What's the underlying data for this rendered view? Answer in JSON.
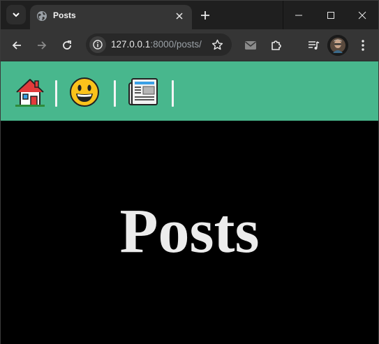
{
  "browser": {
    "tab": {
      "title": "Posts",
      "favicon": "globe-icon"
    },
    "address": {
      "host": "127.0.0.1",
      "rest": ":8000/posts/"
    },
    "icons": {
      "tab_menu": "chevron-down-icon",
      "close_tab": "close-icon",
      "new_tab": "plus-icon",
      "minimize": "minimize-icon",
      "maximize": "maximize-icon",
      "close_window": "close-icon",
      "back": "arrow-left-icon",
      "forward": "arrow-right-icon",
      "reload": "reload-icon",
      "site_info": "info-icon",
      "bookmark": "star-icon",
      "mail": "mail-icon",
      "extensions": "puzzle-icon",
      "media": "media-control-icon",
      "profile": "avatar",
      "menu": "kebab-menu-icon"
    }
  },
  "page": {
    "nav": [
      {
        "icon": "house-emoji-icon"
      },
      {
        "icon": "smiley-emoji-icon"
      },
      {
        "icon": "newspaper-emoji-icon"
      }
    ],
    "heading": "Posts"
  },
  "colors": {
    "navbar": "#48b78d",
    "page_background": "#000000",
    "heading": "#ececec",
    "tab_strip": "#1f1f1f",
    "toolbar": "#353535"
  }
}
